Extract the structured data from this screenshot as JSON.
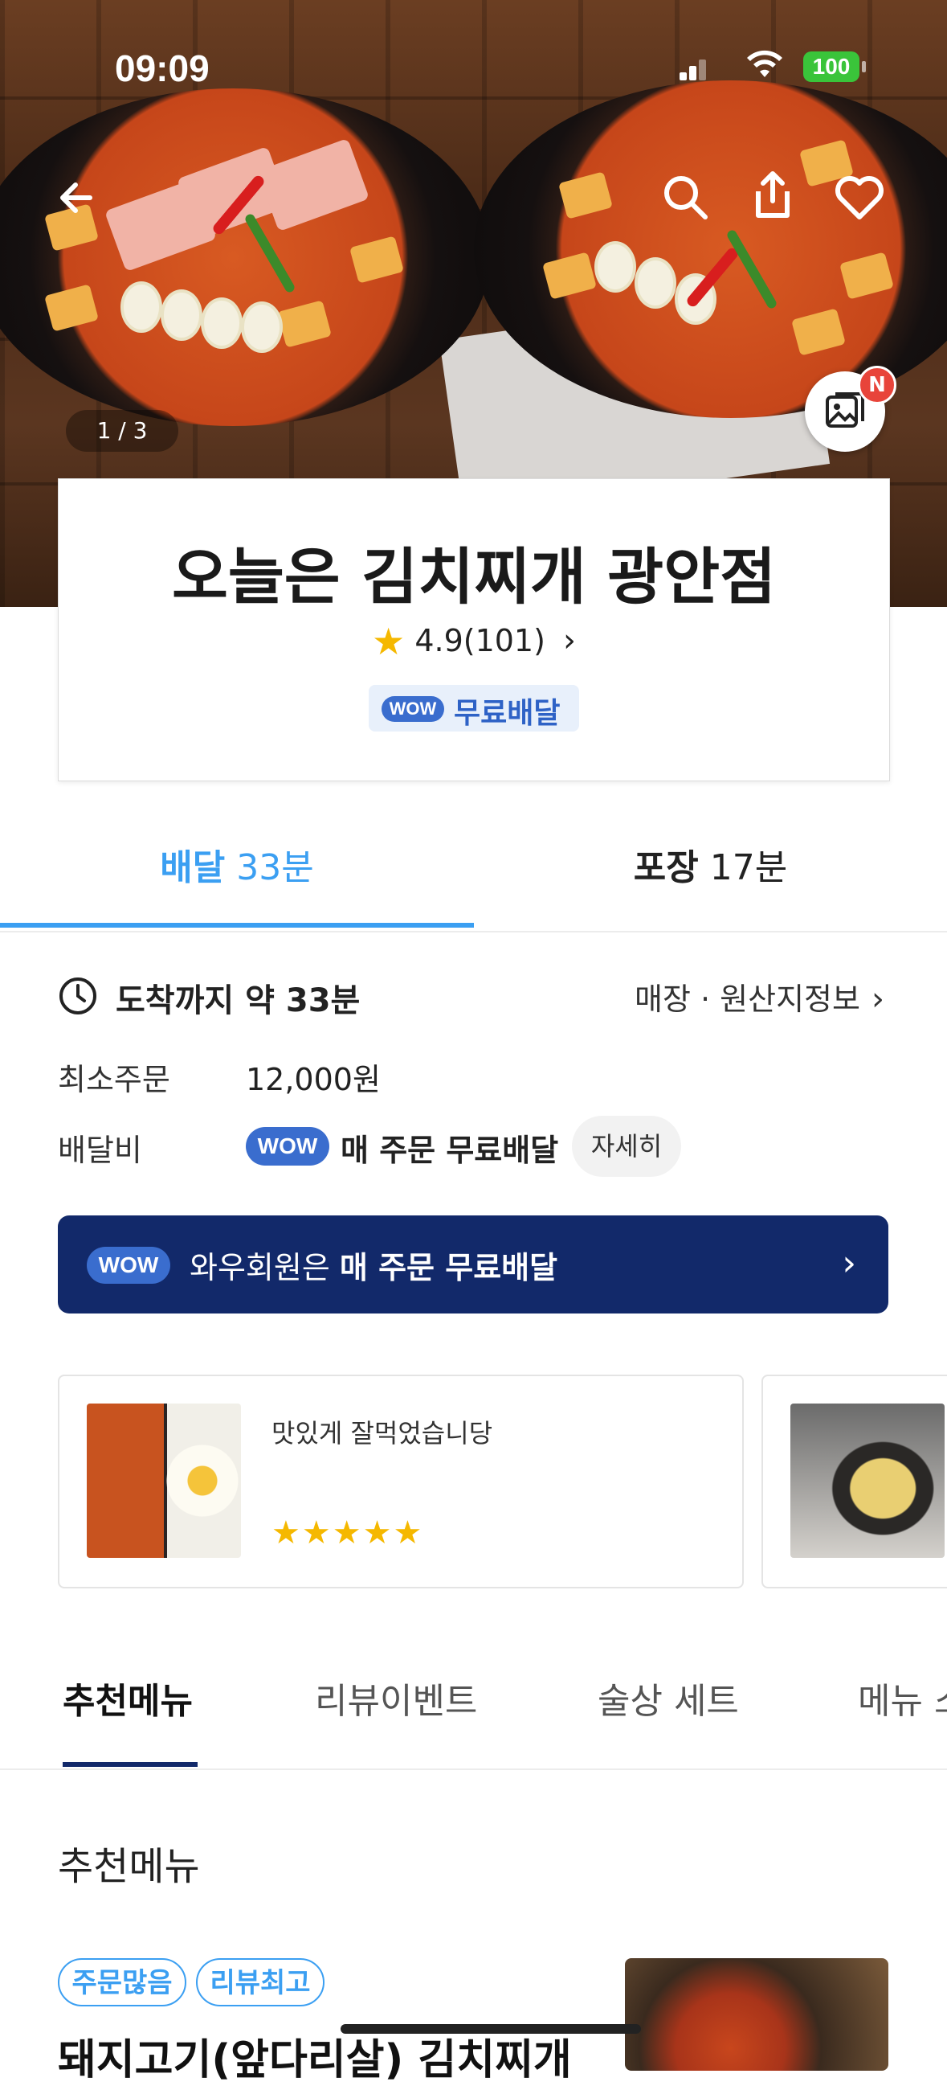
{
  "status_bar": {
    "time": "09:09",
    "battery": "100"
  },
  "hero": {
    "photo_counter": "1 / 3",
    "new_badge": "N"
  },
  "store": {
    "name": "오늘은 김치찌개 광안점",
    "rating": "4.9",
    "review_count": "(101)",
    "wow_label": "WOW",
    "free_delivery": "무료배달"
  },
  "tabs": {
    "delivery_label": "배달",
    "delivery_time": "33분",
    "pickup_label": "포장",
    "pickup_time": "17분"
  },
  "info": {
    "arrival_label": "도착까지 약",
    "arrival_time": "33분",
    "store_info_link": "매장 · 원산지정보",
    "min_order_label": "최소주문",
    "min_order_value": "12,000원",
    "delivery_fee_label": "배달비",
    "delivery_fee_wow": "WOW",
    "delivery_fee_value": "매 주문 무료배달",
    "detail_button": "자세히"
  },
  "wow_banner": {
    "pill": "WOW",
    "text_prefix": "와우회원은",
    "text_bold": "매 주문 무료배달"
  },
  "reviews": [
    {
      "text": "맛있게 잘먹었습니당",
      "stars": "★★★★★",
      "rating": 5
    }
  ],
  "menu_tabs": [
    {
      "label": "추천메뉴",
      "active": true
    },
    {
      "label": "리뷰이벤트",
      "active": false
    },
    {
      "label": "술상 세트",
      "active": false
    },
    {
      "label": "메뉴 소",
      "active": false
    }
  ],
  "section": {
    "title": "추천메뉴",
    "tags": [
      "주문많음",
      "리뷰최고"
    ],
    "item_name": "돼지고기(앞다리살) 김치찌개"
  },
  "colors": {
    "accent_blue": "#3b9ff2",
    "wow_blue": "#3a6dce",
    "banner_navy": "#12296a",
    "star_yellow": "#f5b800",
    "badge_red": "#e8443a"
  }
}
